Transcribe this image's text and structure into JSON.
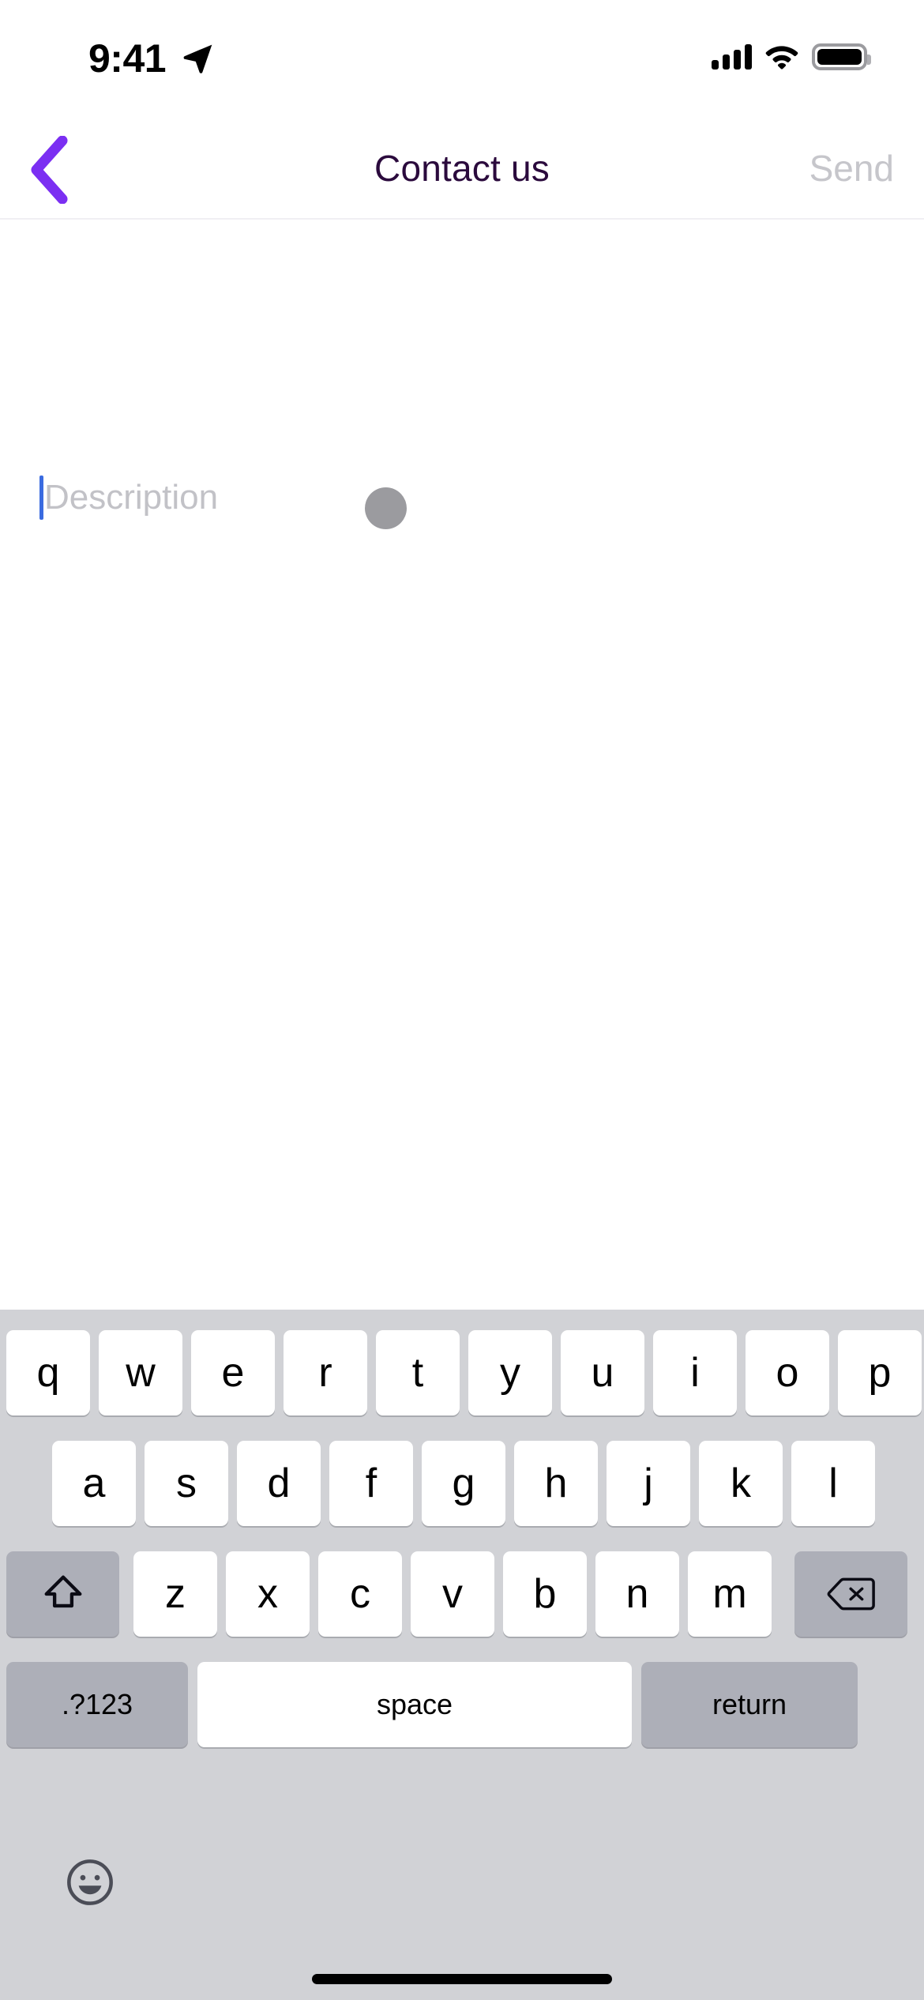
{
  "status_bar": {
    "time": "9:41",
    "location_icon": "location-arrow-icon",
    "cellular_icon": "cellular-signal-icon",
    "wifi_icon": "wifi-icon",
    "battery_icon": "battery-full-icon"
  },
  "header": {
    "back_icon": "chevron-left-icon",
    "title": "Contact us",
    "send_label": "Send",
    "title_color": "#2b0a3d",
    "back_color": "#7b2ff2",
    "send_color": "#c6c6cb"
  },
  "compose": {
    "placeholder": "Description",
    "value": "",
    "caret_color": "#3a6be0",
    "avatar_icon": "gray-circle-avatar",
    "attach_icon": "paperclip-icon"
  },
  "keyboard": {
    "row1": [
      "q",
      "w",
      "e",
      "r",
      "t",
      "y",
      "u",
      "i",
      "o",
      "p"
    ],
    "row2": [
      "a",
      "s",
      "d",
      "f",
      "g",
      "h",
      "j",
      "k",
      "l"
    ],
    "row3_letters": [
      "z",
      "x",
      "c",
      "v",
      "b",
      "n",
      "m"
    ],
    "shift_icon": "shift-arrow-up-icon",
    "backspace_icon": "delete-left-icon",
    "numbers_label": ".?123",
    "space_label": "space",
    "return_label": "return",
    "emoji_icon": "smiley-face-icon",
    "background_color": "#d1d2d6",
    "key_color": "#ffffff",
    "modifier_key_color": "#adafb8"
  },
  "home_indicator": "home-indicator-bar"
}
